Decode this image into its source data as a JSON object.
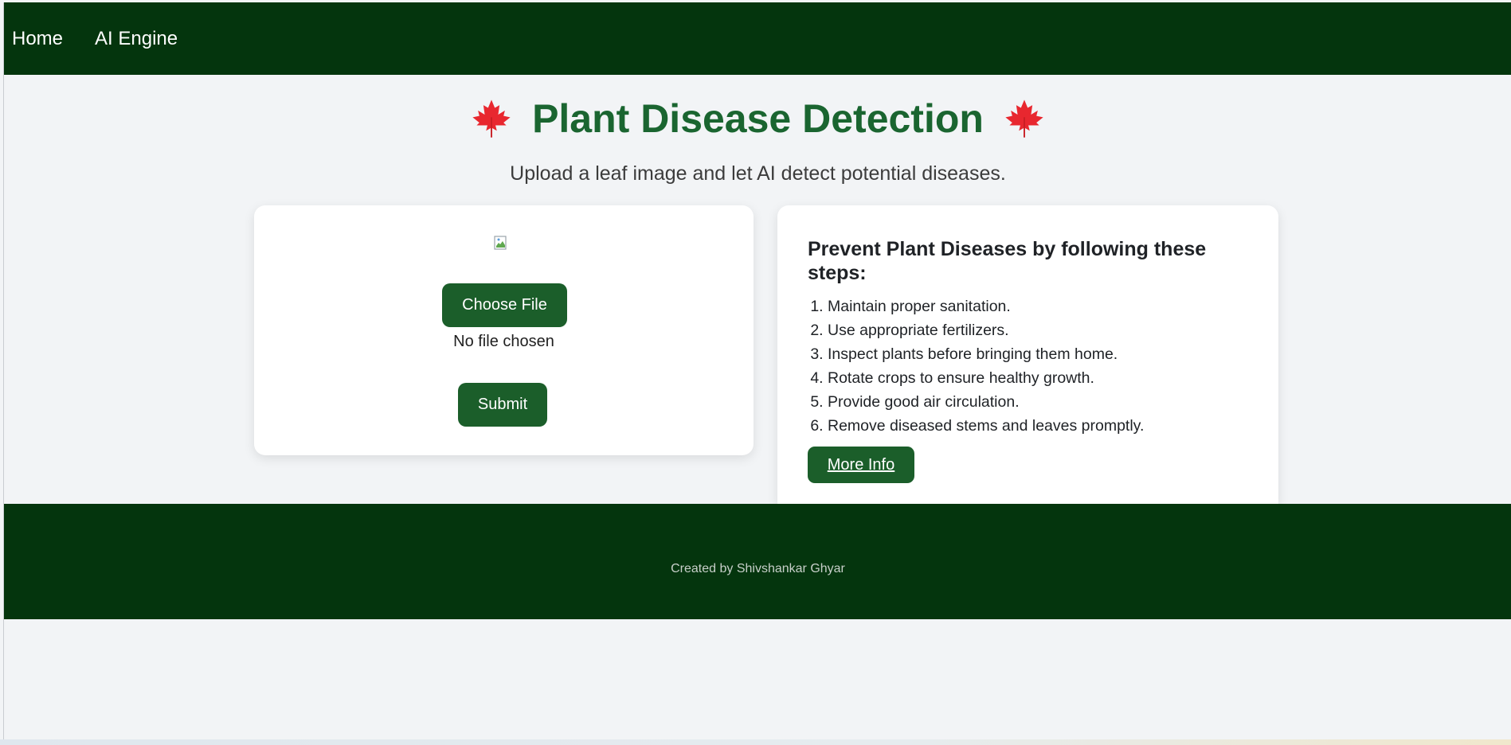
{
  "nav": {
    "home_label": "Home",
    "ai_engine_label": "AI Engine"
  },
  "hero": {
    "title": "Plant Disease Detection",
    "subtitle": "Upload a leaf image and let AI detect potential diseases.",
    "leaf_icon": "maple-leaf-icon",
    "title_color": "#1a6530"
  },
  "upload": {
    "choose_label": "Choose File",
    "file_status": "No file chosen",
    "submit_label": "Submit"
  },
  "tips": {
    "title": "Prevent Plant Diseases by following these steps:",
    "items": [
      "Maintain proper sanitation.",
      "Use appropriate fertilizers.",
      "Inspect plants before bringing them home.",
      "Rotate crops to ensure healthy growth.",
      "Provide good air circulation.",
      "Remove diseased stems and leaves promptly."
    ],
    "more_label": "More Info"
  },
  "footer": {
    "credit": "Created by Shivshankar Ghyar"
  },
  "colors": {
    "nav_bg": "#04350d",
    "button_bg": "#1b5e2a",
    "page_bg": "#f2f4f6"
  }
}
